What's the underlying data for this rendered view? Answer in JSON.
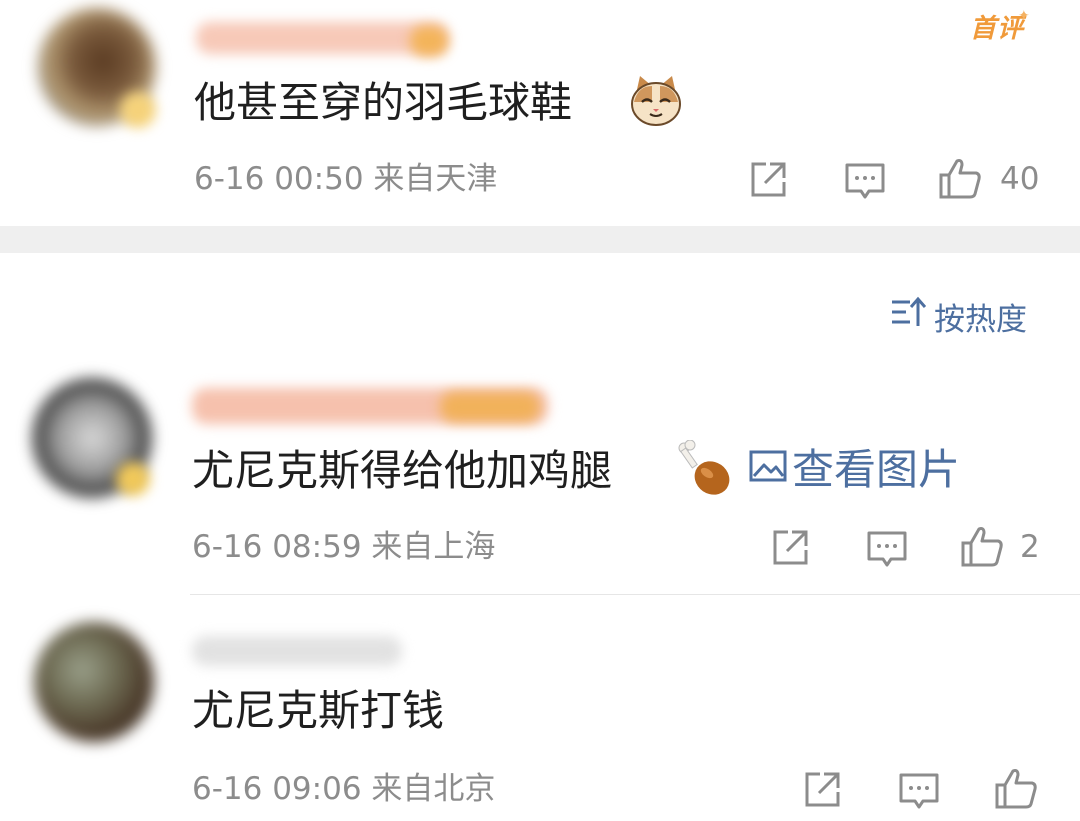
{
  "comments": [
    {
      "text": "他甚至穿的羽毛球鞋",
      "emoji": "cat-face-emoji",
      "time": "6-16 00:50",
      "location": "来自天津",
      "likes": "40",
      "badge": "首评"
    },
    {
      "text": "尤尼克斯得给他加鸡腿",
      "emoji": "drumstick-emoji",
      "view_image": "查看图片",
      "time": "6-16 08:59",
      "location": "来自上海",
      "likes": "2"
    },
    {
      "text": "尤尼克斯打钱",
      "time": "6-16 09:06",
      "location": "来自北京",
      "likes": ""
    }
  ],
  "sort": {
    "label": "按热度"
  },
  "colors": {
    "link": "#4d6fa0",
    "badge": "#f09a3a",
    "meta": "#8c8c8c",
    "divider": "#efefef"
  }
}
